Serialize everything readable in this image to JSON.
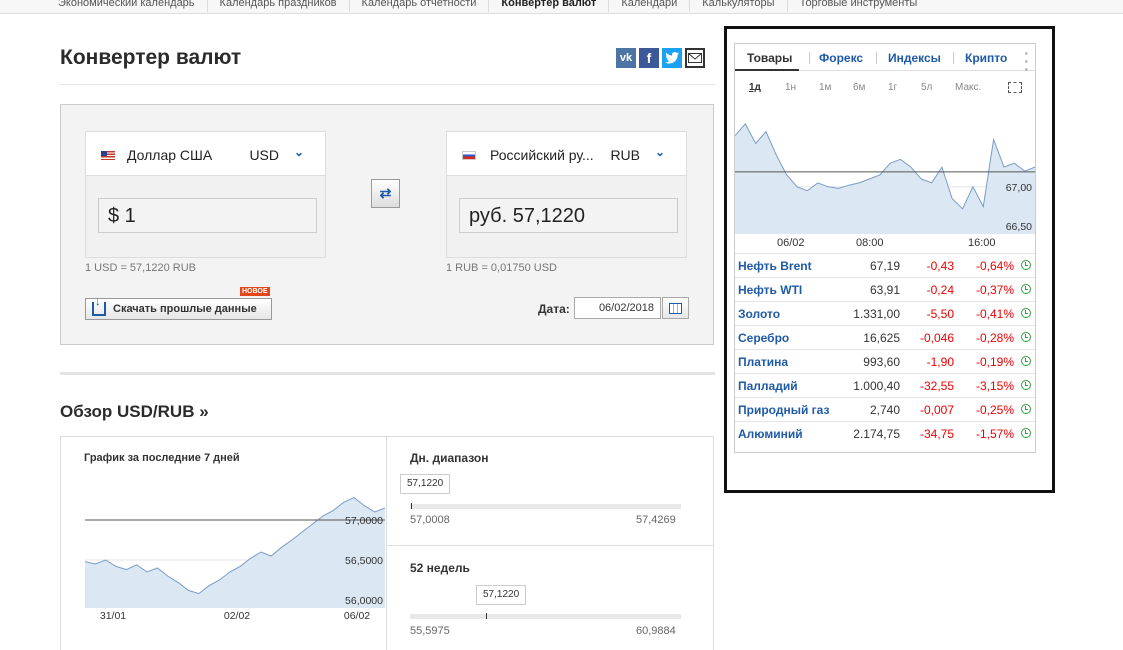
{
  "topnav": [
    "Экономический календарь",
    "Календарь праздников",
    "Календарь отчетности",
    "Конвертер валют",
    "Календари",
    "Калькуляторы",
    "Торговые инструменты"
  ],
  "converter": {
    "title": "Конвертер валют",
    "share": {
      "vk": "vk",
      "fb": "f"
    },
    "from": {
      "name": "Доллар США",
      "code": "USD",
      "value": "$ 1"
    },
    "to": {
      "name": "Российский ру...",
      "code": "RUB",
      "value": "руб. 57,1220"
    },
    "rate_from": "1 USD = 57,1220 RUB",
    "rate_to": "1 RUB = 0,01750 USD",
    "download_label": "Скачать прошлые данные",
    "new_badge": "НОВОЕ",
    "date_label": "Дата:",
    "date_value": "06/02/2018"
  },
  "overview": {
    "title": "Обзор USD/RUB »",
    "chart_title": "График за последние 7 дней",
    "daily_title": "Дн. диапазон",
    "daily_current": "57,1220",
    "daily_low": "57,0008",
    "daily_high": "57,4269",
    "week52_title": "52 недель",
    "week52_current": "57,1220",
    "week52_low": "55,5975",
    "week52_high": "60,9884"
  },
  "widget": {
    "tabs": [
      "Товары",
      "Форекс",
      "Индексы",
      "Крипто"
    ],
    "periods": [
      "1д",
      "1н",
      "1м",
      "6м",
      "1г",
      "5л",
      "Макс."
    ],
    "rows": [
      {
        "name": "Нефть Brent",
        "price": "67,19",
        "chg": "-0,43",
        "pct": "-0,64%"
      },
      {
        "name": "Нефть WTI",
        "price": "63,91",
        "chg": "-0,24",
        "pct": "-0,37%"
      },
      {
        "name": "Золото",
        "price": "1.331,00",
        "chg": "-5,50",
        "pct": "-0,41%"
      },
      {
        "name": "Серебро",
        "price": "16,625",
        "chg": "-0,046",
        "pct": "-0,28%"
      },
      {
        "name": "Платина",
        "price": "993,60",
        "chg": "-1,90",
        "pct": "-0,19%"
      },
      {
        "name": "Палладий",
        "price": "1.000,40",
        "chg": "-32,55",
        "pct": "-3,15%"
      },
      {
        "name": "Природный газ",
        "price": "2,740",
        "chg": "-0,007",
        "pct": "-0,25%"
      },
      {
        "name": "Алюминий",
        "price": "2.174,75",
        "chg": "-34,75",
        "pct": "-1,57%"
      }
    ]
  },
  "chart_data": [
    {
      "type": "area",
      "title": "График за последние 7 дней",
      "x_ticks": [
        "31/01",
        "02/02",
        "06/02"
      ],
      "y_ticks": [
        "57,0000",
        "56,5000",
        "56,0000"
      ],
      "ylim": [
        55.9,
        57.5
      ],
      "reference": 57.0,
      "values": [
        56.48,
        56.45,
        56.5,
        56.42,
        56.38,
        56.44,
        56.35,
        56.4,
        56.3,
        56.22,
        56.12,
        56.08,
        56.18,
        56.25,
        56.35,
        56.42,
        56.52,
        56.6,
        56.55,
        56.66,
        56.75,
        56.85,
        56.95,
        57.05,
        57.12,
        57.22,
        57.28,
        57.18,
        57.1,
        57.15
      ]
    },
    {
      "type": "area",
      "x_ticks": [
        "06/02",
        "08:00",
        "16:00"
      ],
      "y_ticks": [
        "67,00",
        "66,50"
      ],
      "ylim": [
        66.4,
        67.9
      ],
      "reference": 67.19,
      "values": [
        67.65,
        67.8,
        67.55,
        67.7,
        67.4,
        67.15,
        67.0,
        66.95,
        67.05,
        67.0,
        66.98,
        67.02,
        67.05,
        67.1,
        67.15,
        67.3,
        67.35,
        67.25,
        67.1,
        67.05,
        67.25,
        66.85,
        66.72,
        67.0,
        66.75,
        67.6,
        67.25,
        67.3,
        67.2,
        67.25
      ]
    }
  ]
}
